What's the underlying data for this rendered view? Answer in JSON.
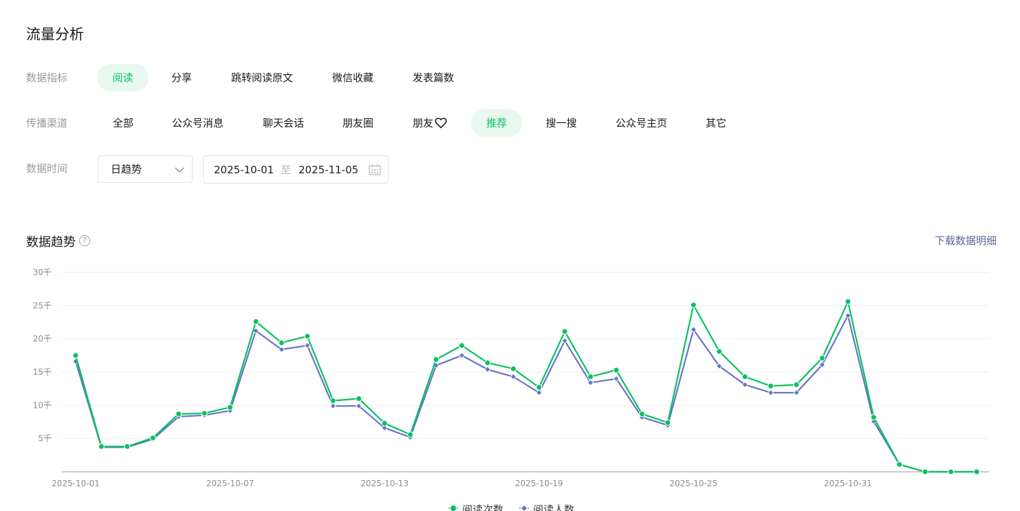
{
  "page": {
    "title": "流量分析"
  },
  "filters": {
    "metric": {
      "label": "数据指标",
      "options": [
        "阅读",
        "分享",
        "跳转阅读原文",
        "微信收藏",
        "发表篇数"
      ],
      "selected": "阅读"
    },
    "channel": {
      "label": "传播渠道",
      "options": [
        "全部",
        "公众号消息",
        "聊天会话",
        "朋友圈",
        "朋友",
        "推荐",
        "搜一搜",
        "公众号主页",
        "其它"
      ],
      "selected": "推荐"
    },
    "time": {
      "label": "数据时间",
      "granularity": "日趋势",
      "start_date": "2025-10-01",
      "separator": "至",
      "end_date": "2025-11-05"
    }
  },
  "trend": {
    "title": "数据趋势",
    "help": "?",
    "download_label": "下载数据明细"
  },
  "colors": {
    "green": "#07c160",
    "blue": "#6673c8",
    "grid": "#eeeeee",
    "accent_bg": "#e9f8ef",
    "link": "#576b95"
  },
  "chart_data": {
    "type": "line",
    "x": [
      "2025-10-01",
      "2025-10-02",
      "2025-10-03",
      "2025-10-04",
      "2025-10-05",
      "2025-10-06",
      "2025-10-07",
      "2025-10-08",
      "2025-10-09",
      "2025-10-10",
      "2025-10-11",
      "2025-10-12",
      "2025-10-13",
      "2025-10-14",
      "2025-10-15",
      "2025-10-16",
      "2025-10-17",
      "2025-10-18",
      "2025-10-19",
      "2025-10-20",
      "2025-10-21",
      "2025-10-22",
      "2025-10-23",
      "2025-10-24",
      "2025-10-25",
      "2025-10-26",
      "2025-10-27",
      "2025-10-28",
      "2025-10-29",
      "2025-10-30",
      "2025-10-31",
      "2025-11-01",
      "2025-11-02",
      "2025-11-03",
      "2025-11-04",
      "2025-11-05"
    ],
    "x_tick_labels": [
      "2025-10-01",
      "2025-10-07",
      "2025-10-13",
      "2025-10-19",
      "2025-10-25",
      "2025-10-31"
    ],
    "y_tick_labels": [
      "5千",
      "10千",
      "15千",
      "20千",
      "25千",
      "30千"
    ],
    "y_ticks": [
      5000,
      10000,
      15000,
      20000,
      25000,
      30000
    ],
    "ylim": [
      0,
      30000
    ],
    "series": [
      {
        "name": "阅读次数",
        "color": "#07c160",
        "marker": "circle",
        "values": [
          17500,
          3800,
          3800,
          5100,
          8700,
          8800,
          9700,
          22600,
          19400,
          20400,
          10700,
          11000,
          7300,
          5600,
          16900,
          19000,
          16400,
          15500,
          12700,
          21100,
          14300,
          15300,
          8700,
          7400,
          25100,
          18100,
          14300,
          12900,
          13100,
          17100,
          25600,
          8200,
          1100,
          0,
          0,
          0
        ]
      },
      {
        "name": "阅读人数",
        "color": "#6673c8",
        "marker": "diamond",
        "values": [
          16600,
          3700,
          3700,
          4900,
          8300,
          8500,
          9200,
          21200,
          18400,
          19000,
          9900,
          9900,
          6600,
          5200,
          16000,
          17500,
          15400,
          14300,
          11900,
          19700,
          13400,
          14000,
          8200,
          7000,
          21400,
          15900,
          13100,
          11900,
          11900,
          16100,
          23500,
          7600,
          1100,
          0,
          0,
          0
        ]
      }
    ],
    "grid": true,
    "legend": "bottom-center"
  }
}
